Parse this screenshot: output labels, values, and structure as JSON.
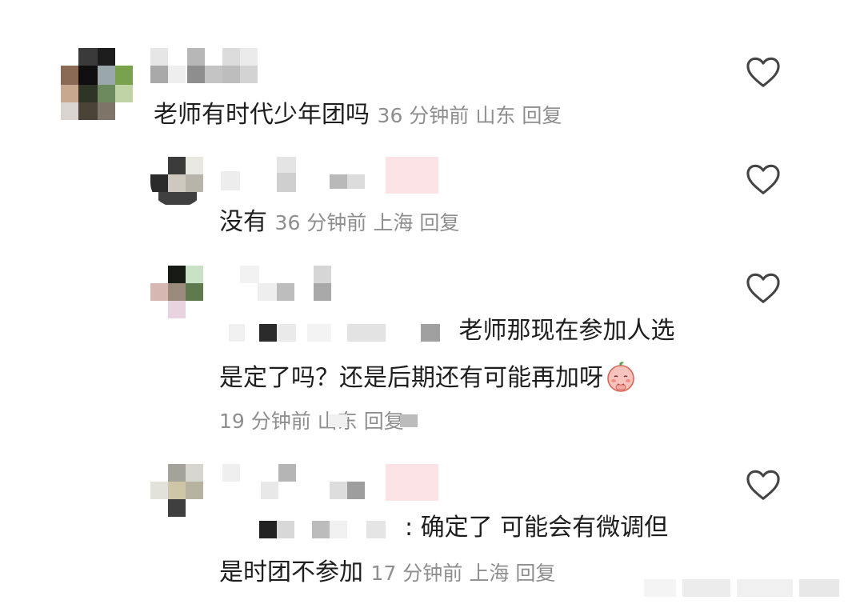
{
  "comments": [
    {
      "text": "老师有时代少年团吗",
      "time": "36 分钟前",
      "location": "山东",
      "reply_label": "回复"
    },
    {
      "text": "没有",
      "time": "36 分钟前",
      "location": "上海",
      "reply_label": "回复"
    },
    {
      "text_line1": "老师那现在参加人选",
      "text_line2": "是定了吗？还是后期还有可能再加呀",
      "time": "19 分钟前",
      "location": "山东",
      "reply_label": "回复"
    },
    {
      "text_line1": ": 确定了 可能会有微调但",
      "text_line2": "是时团不参加",
      "time": "17 分钟前",
      "location": "上海",
      "reply_label": "回复"
    }
  ],
  "icons": {
    "like": "heart-outline-icon",
    "emoji": "shy-face-emoji"
  },
  "colors": {
    "text": "#1e1e1e",
    "meta": "#8e8e8e",
    "icon": "#444444"
  }
}
